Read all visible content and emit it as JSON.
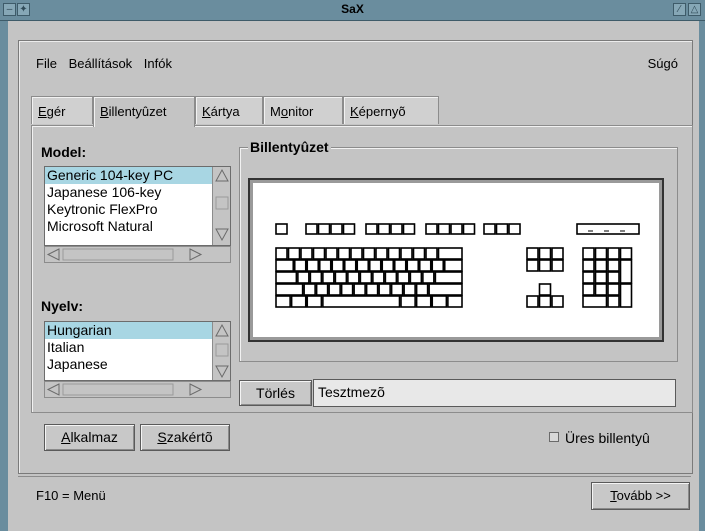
{
  "window": {
    "title": "SaX"
  },
  "menubar": {
    "items": [
      "File",
      "Beállítások",
      "Infók"
    ],
    "help": "Súgó"
  },
  "tabs": [
    {
      "label": "Egér",
      "mnemonic": "E",
      "rest": "gér"
    },
    {
      "label": "Billentyûzet",
      "mnemonic": "B",
      "rest": "illentyûzet"
    },
    {
      "label": "Kártya",
      "mnemonic": "K",
      "rest": "ártya"
    },
    {
      "label": "Monitor",
      "pre": "M",
      "mnemonic": "o",
      "rest": "nitor"
    },
    {
      "label": "Képernyõ",
      "mnemonic": "K",
      "rest": "épernyõ"
    }
  ],
  "model": {
    "label": "Model:",
    "items": [
      "Generic 104-key PC",
      "Japanese 106-key",
      "Keytronic FlexPro",
      "Microsoft Natural"
    ],
    "selected": 0
  },
  "language": {
    "label": "Nyelv:",
    "items": [
      "Hungarian",
      "Italian",
      "Japanese"
    ],
    "selected": 0
  },
  "keyboard_group": {
    "title": "Billentyûzet"
  },
  "test": {
    "clear_label": "Törlés",
    "field_value": "Tesztmezõ"
  },
  "buttons": {
    "apply": {
      "mnemonic": "A",
      "rest": "lkalmaz"
    },
    "expert": {
      "mnemonic": "S",
      "rest": "zakértõ"
    },
    "next": {
      "mnemonic": "T",
      "rest": "ovább >>"
    }
  },
  "empty_key": {
    "label": "Üres billentyû",
    "checked": false
  },
  "status": {
    "text": "F10 = Menü"
  },
  "colors": {
    "titlebar": "#6a8d9e",
    "selection": "#a8d6e3",
    "background": "#c4c4c4"
  }
}
